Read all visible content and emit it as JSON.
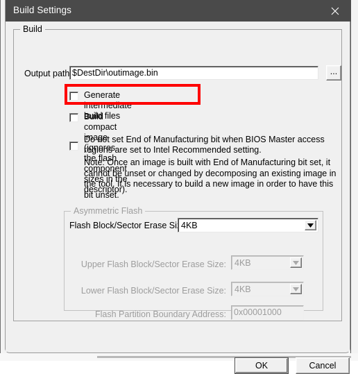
{
  "window": {
    "title": "Build Settings",
    "close_icon": "close-icon"
  },
  "build_group": {
    "legend": "Build",
    "output_path": {
      "label": "Output path:",
      "value": "$DestDir\\outimage.bin",
      "browse_label": "..."
    },
    "checkboxes": [
      {
        "id": "generate-intermediate-build-files",
        "label": "Generate intermediate build files",
        "checked": false,
        "highlighted": true
      },
      {
        "id": "build-compact-image",
        "label": "Build compact image (ignores the flash component sizes in the descriptor).",
        "checked": false,
        "highlighted": false
      },
      {
        "id": "do-not-set-end-of-manufacturing-bit",
        "label": "Do not set End of Manufacturing bit when BIOS Master access regions are set to Intel Recommended setting.",
        "checked": false,
        "highlighted": false
      }
    ],
    "note": "Note: Once an image is built with End of Manufacturing bit set, it cannot be unset or changed by decomposing an existing image in the tool. It is necessary to build a new image in order to have this bit unset.",
    "flash_erase_size": {
      "label": "Flash Block/Sector Erase Size:",
      "value": "4KB",
      "enabled": true
    }
  },
  "asymmetric_flash_group": {
    "legend": "Asymmetric Flash",
    "enabled": false,
    "fields": [
      {
        "id": "upper-flash-erase-size",
        "label": "Upper Flash Block/Sector Erase Size:",
        "value": "4KB",
        "type": "combobox"
      },
      {
        "id": "lower-flash-erase-size",
        "label": "Lower Flash Block/Sector Erase Size:",
        "value": "4KB",
        "type": "combobox"
      },
      {
        "id": "flash-partition-boundary-address",
        "label": "Flash Partition Boundary Address:",
        "value": "0x00001000",
        "type": "textbox"
      }
    ]
  },
  "footer": {
    "ok_label": "OK",
    "cancel_label": "Cancel"
  },
  "annotation": {
    "color": "#fe0000",
    "target": "generate-intermediate-build-files"
  }
}
